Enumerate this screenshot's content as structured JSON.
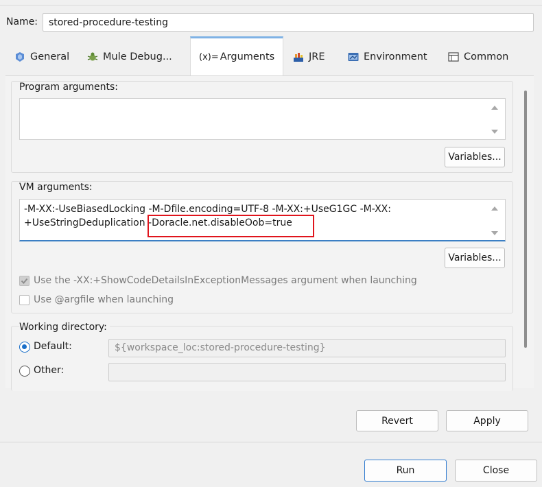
{
  "name": {
    "label": "Name:",
    "value": "stored-procedure-testing"
  },
  "tabs": [
    {
      "label": "General",
      "icon": "gear-person-icon"
    },
    {
      "label": "Mule Debug...",
      "icon": "bug-icon"
    },
    {
      "label": "Arguments",
      "icon": "arguments-icon",
      "icon_text": "(x)=",
      "active": true
    },
    {
      "label": "JRE",
      "icon": "jre-icon"
    },
    {
      "label": "Environment",
      "icon": "environment-icon"
    },
    {
      "label": "Common",
      "icon": "common-icon"
    }
  ],
  "program_args": {
    "label": "Program arguments:",
    "value": "",
    "variables_label": "Variables..."
  },
  "vm_args": {
    "label": "VM arguments:",
    "line1": "-M-XX:-UseBiasedLocking -M-Dfile.encoding=UTF-8 -M-XX:+UseG1GC -M-XX:",
    "line2": "+UseStringDeduplication -Doracle.net.disableOob=true",
    "variables_label": "Variables..."
  },
  "options": {
    "show_code_details": {
      "label": "Use the -XX:+ShowCodeDetailsInExceptionMessages argument when launching",
      "checked": true
    },
    "argfile": {
      "label": "Use @argfile when launching",
      "checked": false
    }
  },
  "working_dir": {
    "label": "Working directory:",
    "default_label": "Default:",
    "default_value": "${workspace_loc:stored-procedure-testing}",
    "other_label": "Other:",
    "other_value": ""
  },
  "buttons": {
    "revert": "Revert",
    "apply": "Apply",
    "run": "Run",
    "close": "Close"
  },
  "colors": {
    "accent": "#2e7bd0",
    "highlight": "#e0141c",
    "tab_active_top": "#7fb2e5"
  }
}
